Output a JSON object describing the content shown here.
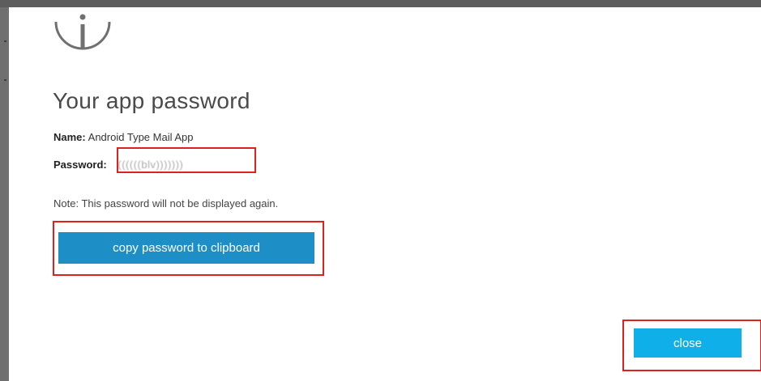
{
  "dialog": {
    "icon": "info-icon",
    "title": "Your app password",
    "name_label": "Name:",
    "name_value": "Android Type Mail App",
    "password_label": "Password:",
    "password_value": "((((((blv)))))))",
    "note": "Note: This password will not be displayed again.",
    "copy_button_label": "copy password to clipboard",
    "close_button_label": "close"
  },
  "colors": {
    "copy_button": "#1e8fc6",
    "close_button": "#0fb0ea",
    "highlight_box": "#e0201b",
    "background_frame": "#5d5d5d"
  }
}
